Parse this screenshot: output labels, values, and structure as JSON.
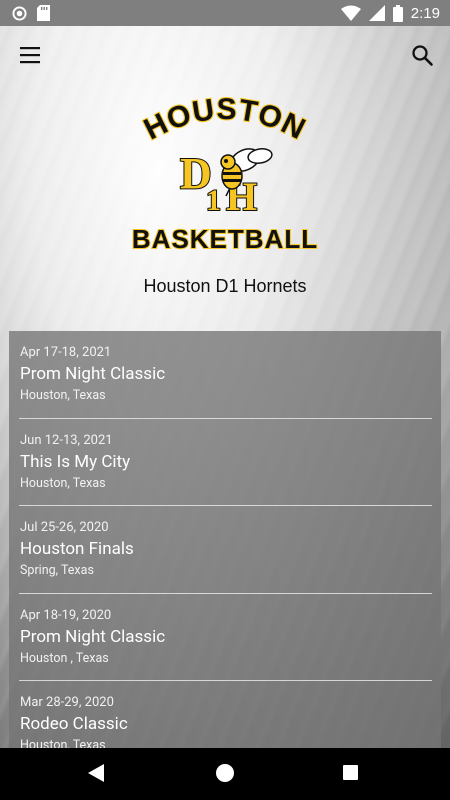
{
  "status_bar": {
    "time": "2:19",
    "icons": [
      "sync-icon",
      "sd-card-icon",
      "wifi-icon",
      "signal-icon",
      "battery-icon"
    ]
  },
  "header": {
    "menu_icon": "hamburger-menu-icon",
    "search_icon": "search-icon"
  },
  "logo": {
    "top_text": "HOUSTON",
    "bottom_text": "BASKETBALL",
    "monogram_d": "D",
    "monogram_1": "1",
    "monogram_h": "H",
    "colors": {
      "gold": "#f5c623",
      "black": "#111111"
    }
  },
  "team": {
    "name": "Houston D1 Hornets"
  },
  "events": [
    {
      "date": "Apr 17-18, 2021",
      "name": "Prom Night Classic",
      "location": "Houston, Texas"
    },
    {
      "date": "Jun 12-13, 2021",
      "name": "This Is My City",
      "location": "Houston, Texas"
    },
    {
      "date": "Jul 25-26, 2020",
      "name": "Houston Finals",
      "location": "Spring, Texas"
    },
    {
      "date": "Apr 18-19, 2020",
      "name": "Prom Night Classic",
      "location": "Houston , Texas"
    },
    {
      "date": "Mar 28-29, 2020",
      "name": "Rodeo Classic",
      "location": "Houston, Texas"
    }
  ],
  "nav_bar": {
    "icons": [
      "back-icon",
      "home-icon",
      "recents-icon"
    ]
  }
}
